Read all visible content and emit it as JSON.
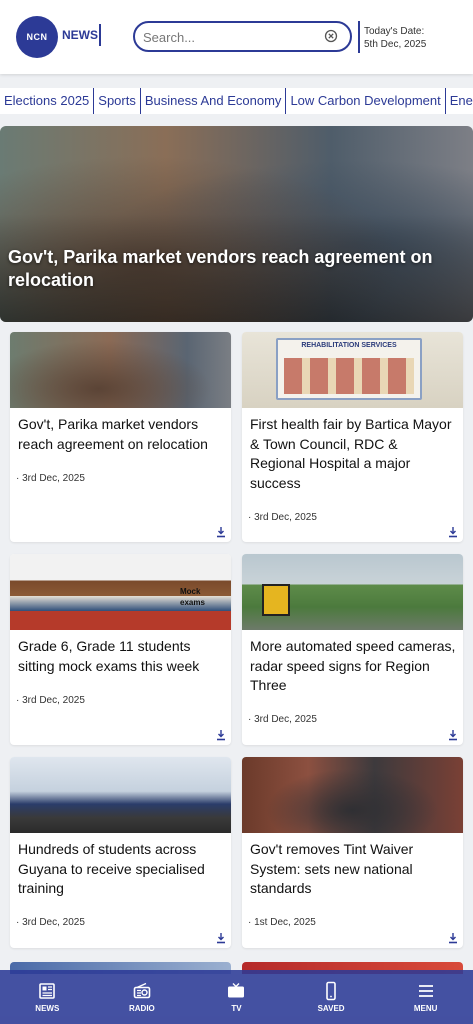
{
  "header": {
    "logo_text": "NCN",
    "brand_label": "NEWS",
    "search_placeholder": "Search...",
    "date_label": "Today's Date:",
    "date_value": "5th Dec, 2025"
  },
  "categories": [
    "Elections 2025",
    "Sports",
    "Business And Economy",
    "Low Carbon Development",
    "Ene"
  ],
  "hero": {
    "title": "Gov't, Parika market vendors reach agreement on relocation"
  },
  "cards": [
    {
      "title": "Gov't, Parika market vendors reach agreement on relocation",
      "date": "· 3rd Dec, 2025"
    },
    {
      "title": "First health fair by Bartica Mayor & Town Council, RDC & Regional Hospital a major success",
      "date": "· 3rd Dec, 2025",
      "image_text": "REHABILITATION SERVICES"
    },
    {
      "title": "Grade 6, Grade 11 students sitting mock exams this week",
      "date": "· 3rd Dec, 2025",
      "image_text": "Mock exams"
    },
    {
      "title": "More automated speed cameras, radar speed signs for Region Three",
      "date": "· 3rd Dec, 2025"
    },
    {
      "title": "Hundreds of students across Guyana to receive specialised training",
      "date": "· 3rd Dec, 2025"
    },
    {
      "title": "Gov't removes Tint Waiver System: sets new national standards",
      "date": "· 1st Dec, 2025"
    }
  ],
  "bottom_nav": [
    {
      "label": "NEWS",
      "icon": "newspaper-icon"
    },
    {
      "label": "RADIO",
      "icon": "radio-icon"
    },
    {
      "label": "TV",
      "icon": "tv-icon"
    },
    {
      "label": "SAVED",
      "icon": "phone-icon"
    },
    {
      "label": "MENU",
      "icon": "menu-icon"
    }
  ],
  "colors": {
    "brand": "#2c3a96",
    "background": "#eef0f3"
  }
}
